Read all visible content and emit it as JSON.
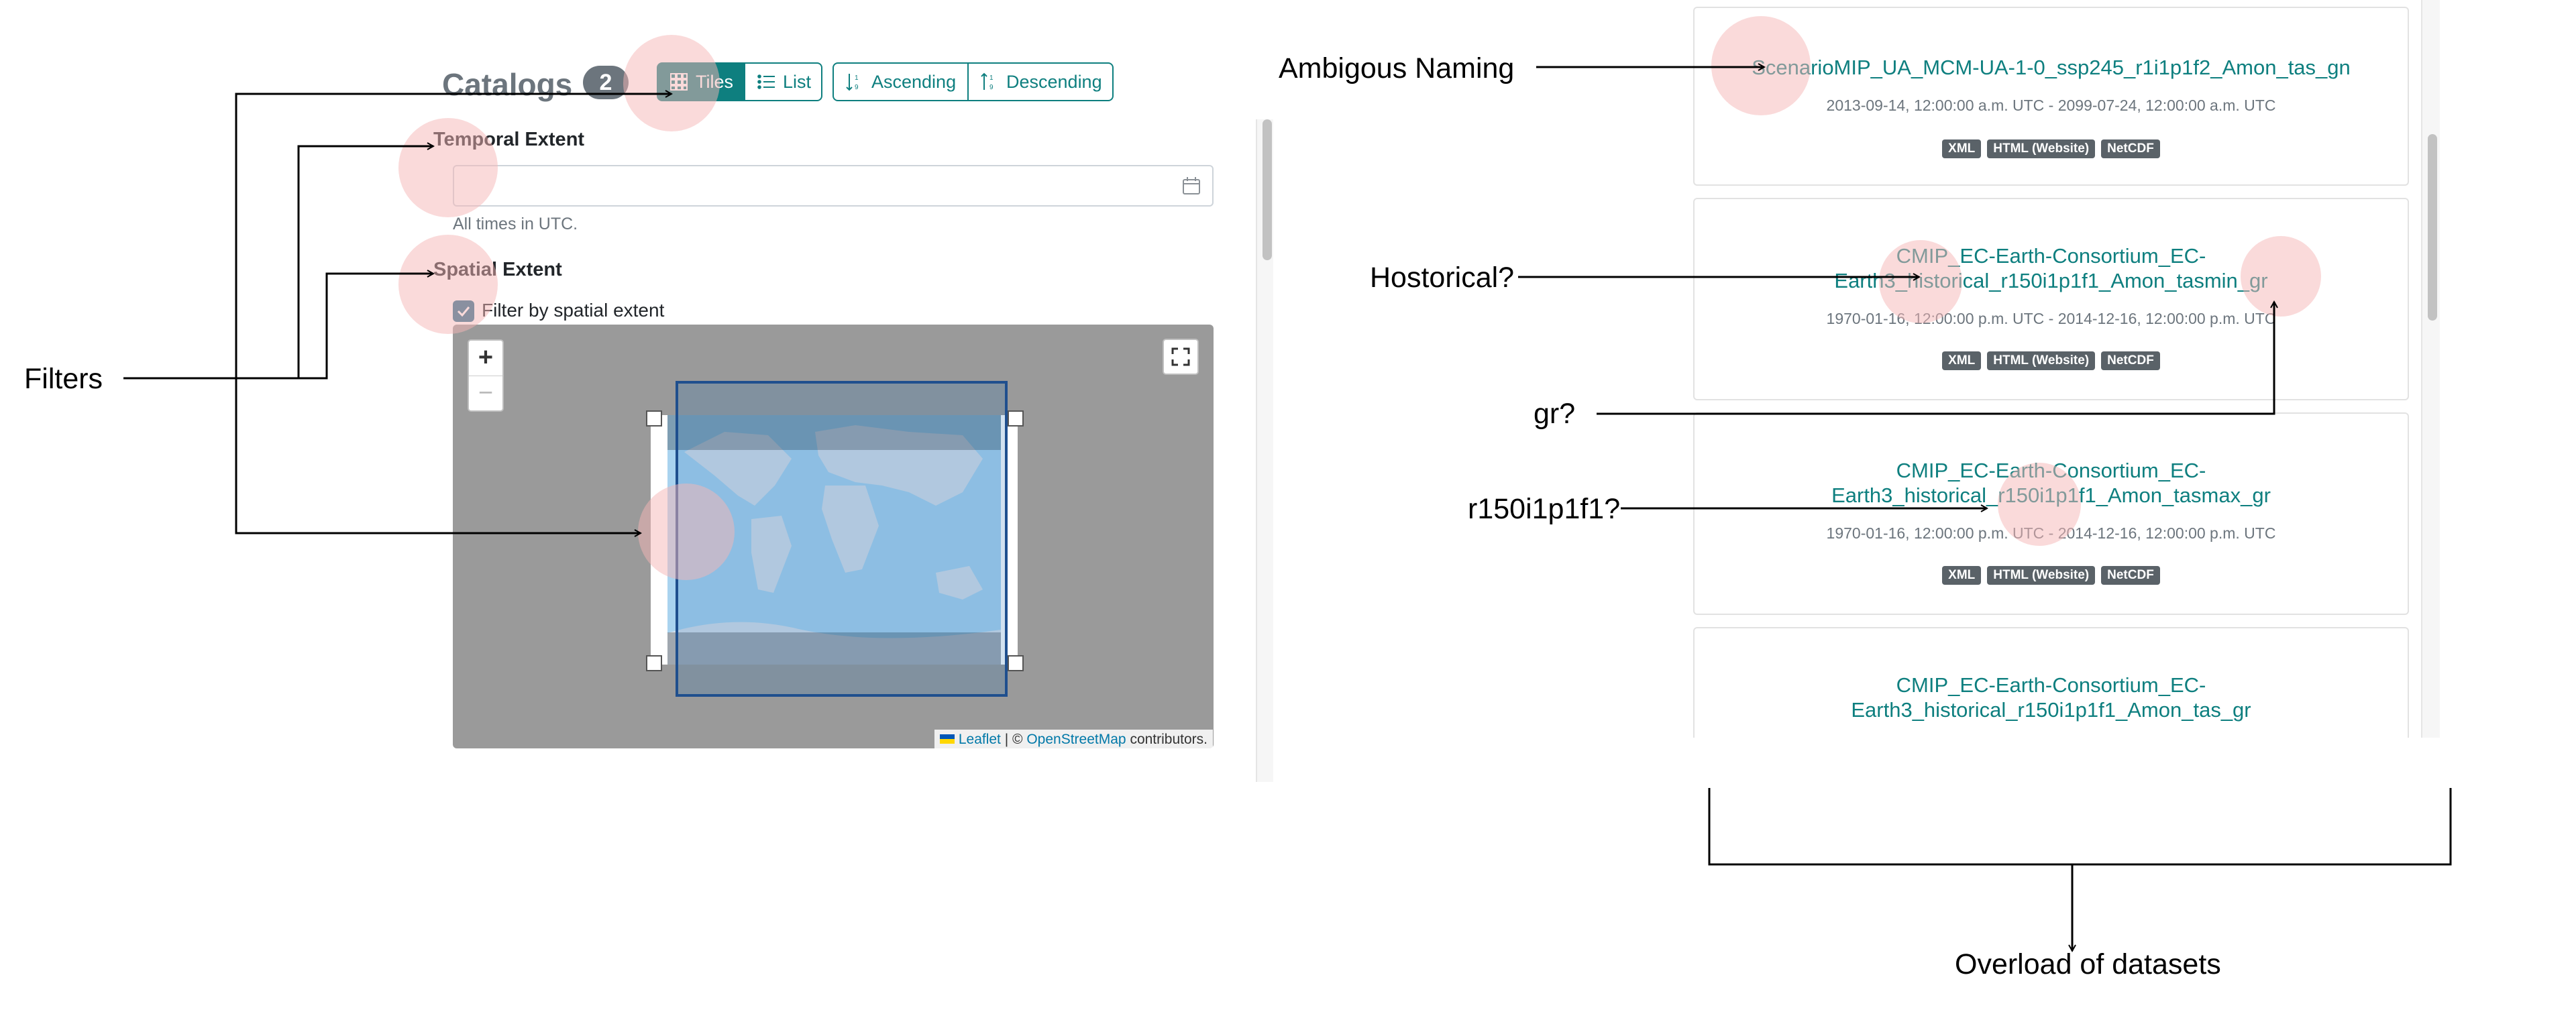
{
  "catalogs": {
    "title": "Catalogs",
    "count": "2"
  },
  "toolbar": {
    "tiles_label": "Tiles",
    "list_label": "List",
    "ascending_label": "Ascending",
    "descending_label": "Descending"
  },
  "filters": {
    "temporal_label": "Temporal Extent",
    "date_value": "",
    "utc_note": "All times in UTC.",
    "spatial_label": "Spatial Extent",
    "spatial_checkbox_label": "Filter by spatial extent",
    "spatial_checked": true
  },
  "map": {
    "zoom_in": "+",
    "zoom_out": "−",
    "attribution": {
      "leaflet": "Leaflet",
      "sep": " | © ",
      "osm": "OpenStreetMap",
      "suffix": " contributors."
    }
  },
  "datasets": [
    {
      "title": "ScenarioMIP_UA_MCM-UA-1-0_ssp245_r1i1p1f2_Amon_tas_gn",
      "dates": "2013-09-14, 12:00:00 a.m. UTC - 2099-07-24, 12:00:00 a.m. UTC",
      "badges": [
        "XML",
        "HTML (Website)",
        "NetCDF"
      ]
    },
    {
      "title": "CMIP_EC-Earth-Consortium_EC-Earth3_historical_r150i1p1f1_Amon_tasmin_gr",
      "dates": "1970-01-16, 12:00:00 p.m. UTC - 2014-12-16, 12:00:00 p.m. UTC",
      "badges": [
        "XML",
        "HTML (Website)",
        "NetCDF"
      ]
    },
    {
      "title": "CMIP_EC-Earth-Consortium_EC-Earth3_historical_r150i1p1f1_Amon_tasmax_gr",
      "dates": "1970-01-16, 12:00:00 p.m. UTC - 2014-12-16, 12:00:00 p.m. UTC",
      "badges": [
        "XML",
        "HTML (Website)",
        "NetCDF"
      ]
    },
    {
      "title": "CMIP_EC-Earth-Consortium_EC-Earth3_historical_r150i1p1f1_Amon_tas_gr",
      "dates": "",
      "badges": []
    }
  ],
  "annotations": {
    "filters": "Filters",
    "ambiguous_naming": "Ambigous Naming",
    "historical": "Hostorical?",
    "gr": "gr?",
    "member": "r150i1p1f1?",
    "overload": "Overload of datasets"
  },
  "colors": {
    "accent": "#0e7f7f",
    "secondary": "#6c757d",
    "badge": "#5a6268",
    "map_bg": "#9a9a9a",
    "selection": "#1f6fb4",
    "highlight": "#f5b6b6"
  }
}
